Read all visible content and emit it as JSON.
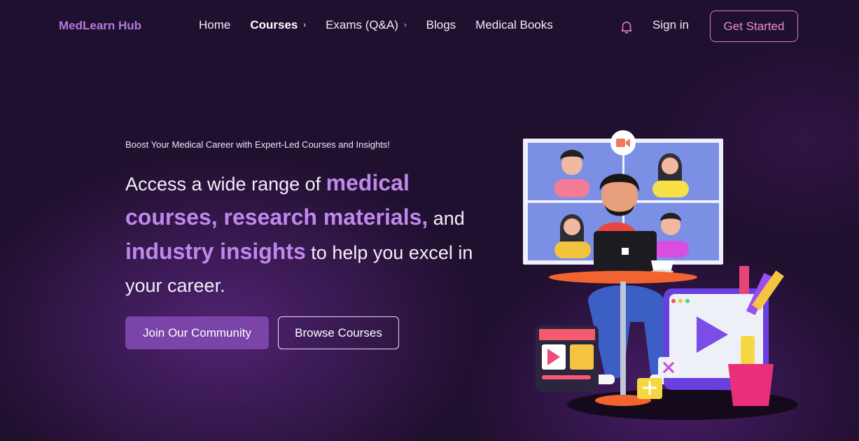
{
  "nav": {
    "logo": "MedLearn Hub",
    "links": [
      {
        "label": "Home",
        "has_chevron": false
      },
      {
        "label": "Courses",
        "has_chevron": true,
        "active": true
      },
      {
        "label": "Exams (Q&A)",
        "has_chevron": true
      },
      {
        "label": "Blogs",
        "has_chevron": false
      },
      {
        "label": "Medical Books",
        "has_chevron": false
      }
    ],
    "chevron": "›",
    "bell_icon": "bell-icon",
    "signin": "Sign in",
    "cta": "Get Started"
  },
  "hero": {
    "eyebrow": "Boost Your Medical Career with Expert-Led Courses and Insights!",
    "headline": {
      "part1": "Access a wide range of ",
      "hl1": "medical courses, research materials,",
      "part2": " and ",
      "hl2": "industry insights",
      "part3": " to help you excel in your career."
    },
    "primary_button": "Join Our Community",
    "secondary_button": "Browse Courses"
  },
  "colors": {
    "background": "#20102f",
    "logo": "#b07ae0",
    "highlight": "#c088ec",
    "primary_button": "#7b44a8",
    "cta_border": "#e07ab8"
  },
  "illustration": {
    "description_icon": "online-learning-illustration"
  }
}
